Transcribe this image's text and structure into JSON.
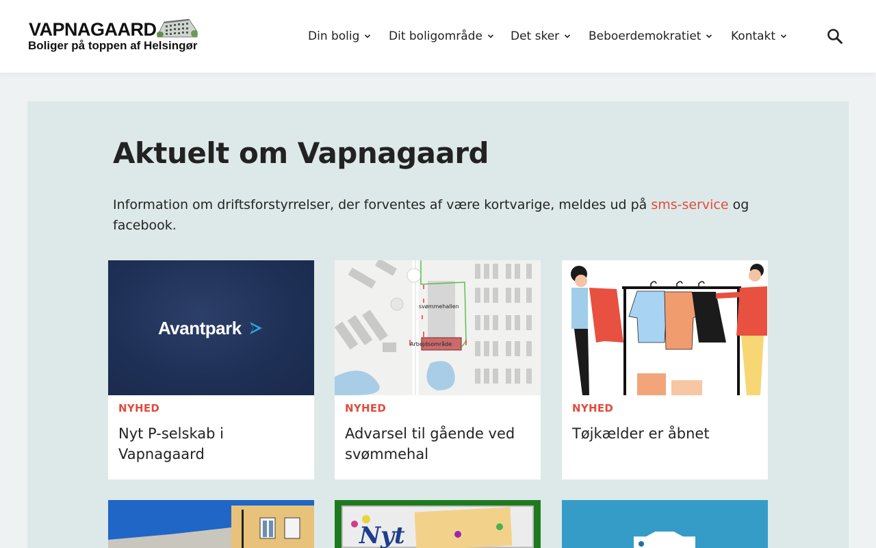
{
  "header": {
    "logo": {
      "name": "VAPNAGAARD",
      "tagline": "Boliger på toppen af Helsingør"
    },
    "nav": [
      {
        "label": "Din bolig"
      },
      {
        "label": "Dit boligområde"
      },
      {
        "label": "Det sker"
      },
      {
        "label": "Beboerdemokratiet"
      },
      {
        "label": "Kontakt"
      }
    ],
    "search_icon": "search-icon"
  },
  "main": {
    "title": "Aktuelt om Vapnagaard",
    "intro_before": "Information om driftsforstyrrelser, der forventes af være kortvarige, meldes ud på ",
    "intro_link": "sms-service",
    "intro_after": " og facebook.",
    "cards": [
      {
        "tag": "NYHED",
        "title": "Nyt P-selskab i Vapnagaard",
        "image_text": "Avantpark"
      },
      {
        "tag": "NYHED",
        "title": "Advarsel til gående ved svømmehal",
        "map_labels": [
          "svømmehallen",
          "Arbejdsområde"
        ]
      },
      {
        "tag": "NYHED",
        "title": "Tøjkælder er åbnet"
      },
      {
        "tag": "",
        "title": ""
      },
      {
        "tag": "",
        "title": "",
        "image_text": "Nyt"
      },
      {
        "tag": "",
        "title": ""
      }
    ]
  },
  "colors": {
    "accent": "#e14b3c",
    "panel": "#dde9e8",
    "page_bg": "#eef2f3",
    "avantpark_bg": "#1e2f55"
  }
}
